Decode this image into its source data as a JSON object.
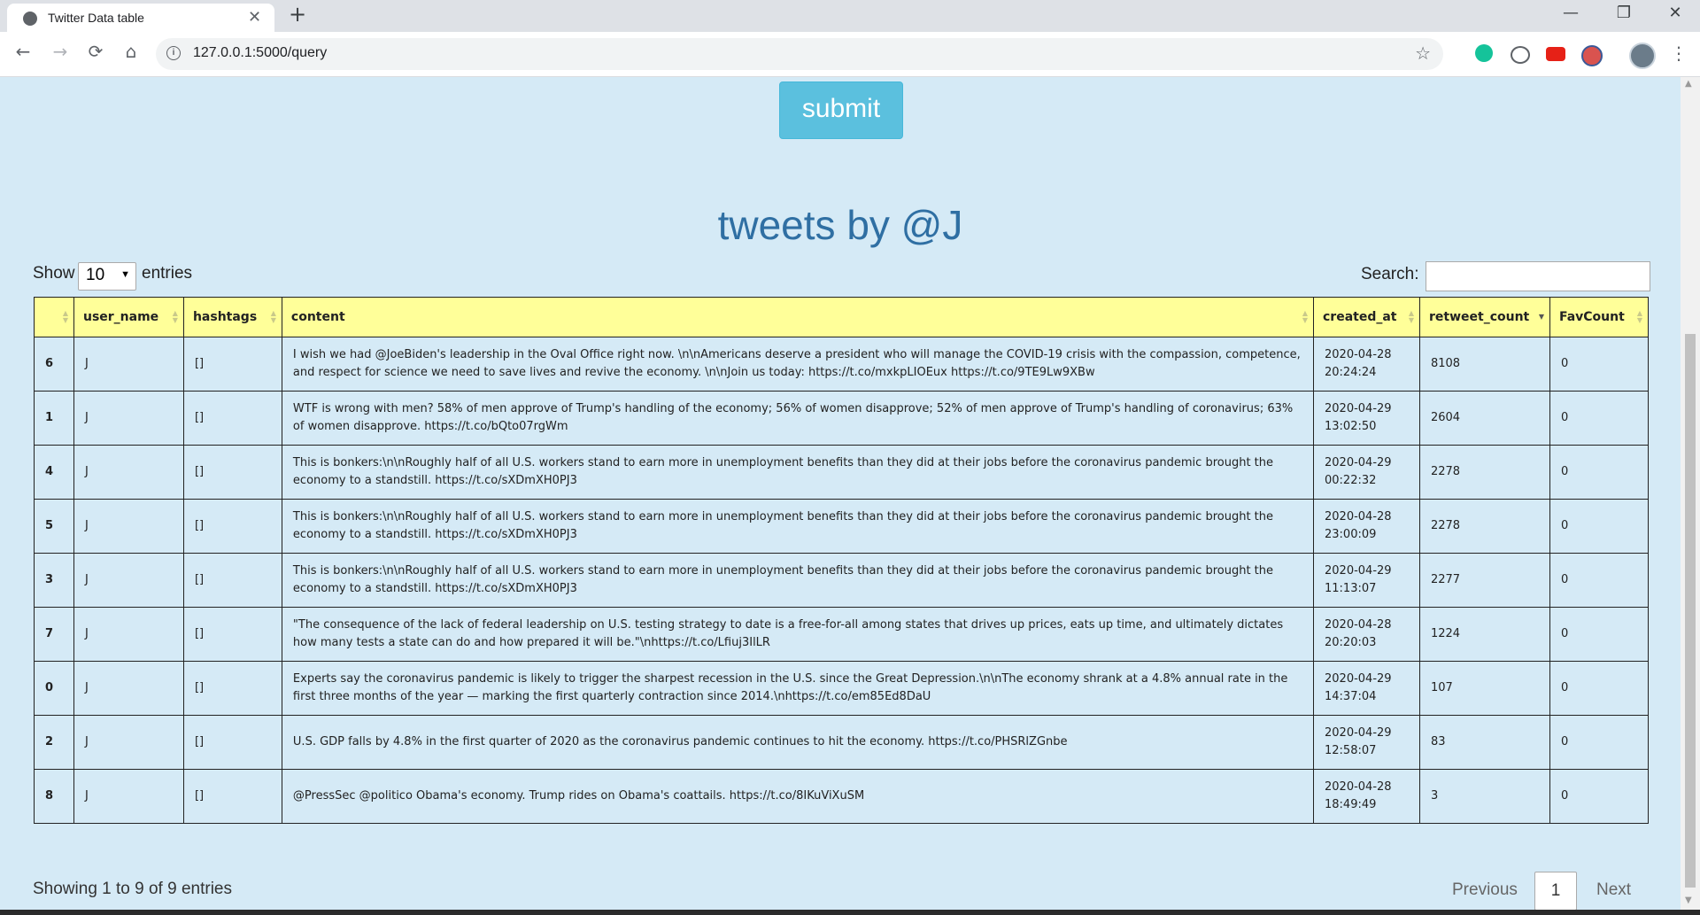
{
  "browser": {
    "tab_title": "Twitter Data table",
    "tab_close": "✕",
    "new_tab": "+",
    "url": "127.0.0.1:5000/query",
    "buttons": {
      "back": "←",
      "forward": "→",
      "reload": "⟳",
      "home": "⌂",
      "star": "☆",
      "menu": "⋮",
      "minimize": "—",
      "maximize": "❐",
      "close": "✕"
    },
    "icons": [
      "grammarly-icon",
      "extension-icon",
      "youtube-icon",
      "extension-icon-2"
    ],
    "colors": {
      "grammarly": "#15c39a",
      "youtube": "#e62117"
    }
  },
  "form": {
    "submit_label": "submit"
  },
  "page_title": "tweets by @J",
  "length_menu": {
    "show_label": "Show",
    "value": "10",
    "entries_label": "entries"
  },
  "search": {
    "label": "Search:",
    "value": ""
  },
  "table": {
    "columns": [
      "",
      "user_name",
      "hashtags",
      "content",
      "created_at",
      "retweet_count",
      "FavCount"
    ],
    "sorted_column": "retweet_count",
    "sort_direction": "desc",
    "rows": [
      [
        "6",
        "J",
        "[]",
        "I wish we had @JoeBiden's leadership in the Oval Office right now. \\n\\nAmericans deserve a president who will manage the COVID-19 crisis with the compassion, competence, and respect for science we need to save lives and revive the economy. \\n\\nJoin us today: https://t.co/mxkpLIOEux https://t.co/9TE9Lw9XBw",
        "2020-04-28 20:24:24",
        "8108",
        "0"
      ],
      [
        "1",
        "J",
        "[]",
        "WTF is wrong with men? 58% of men approve of Trump's handling of the economy; 56% of women disapprove; 52% of men approve of Trump's handling of coronavirus; 63% of women disapprove. https://t.co/bQto07rgWm",
        "2020-04-29 13:02:50",
        "2604",
        "0"
      ],
      [
        "4",
        "J",
        "[]",
        "This is bonkers:\\n\\nRoughly half of all U.S. workers stand to earn more in unemployment benefits than they did at their jobs before the coronavirus pandemic brought the economy to a standstill. https://t.co/sXDmXH0PJ3",
        "2020-04-29 00:22:32",
        "2278",
        "0"
      ],
      [
        "5",
        "J",
        "[]",
        "This is bonkers:\\n\\nRoughly half of all U.S. workers stand to earn more in unemployment benefits than they did at their jobs before the coronavirus pandemic brought the economy to a standstill. https://t.co/sXDmXH0PJ3",
        "2020-04-28 23:00:09",
        "2278",
        "0"
      ],
      [
        "3",
        "J",
        "[]",
        "This is bonkers:\\n\\nRoughly half of all U.S. workers stand to earn more in unemployment benefits than they did at their jobs before the coronavirus pandemic brought the economy to a standstill. https://t.co/sXDmXH0PJ3",
        "2020-04-29 11:13:07",
        "2277",
        "0"
      ],
      [
        "7",
        "J",
        "[]",
        "\"The consequence of the lack of federal leadership on U.S. testing strategy to date is a free-for-all among states that drives up prices, eats up time, and ultimately dictates how many tests a state can do and how prepared it will be.\"\\nhttps://t.co/Lfiuj3IlLR",
        "2020-04-28 20:20:03",
        "1224",
        "0"
      ],
      [
        "0",
        "J",
        "[]",
        "Experts say the coronavirus pandemic is likely to trigger the sharpest recession in the U.S. since the Great Depression.\\n\\nThe economy shrank at a 4.8% annual rate in the first three months of the year — marking the first quarterly contraction since 2014.\\nhttps://t.co/em85Ed8DaU",
        "2020-04-29 14:37:04",
        "107",
        "0"
      ],
      [
        "2",
        "J",
        "[]",
        "U.S. GDP falls by 4.8% in the first quarter of 2020 as the coronavirus pandemic continues to hit the economy. https://t.co/PHSRlZGnbe",
        "2020-04-29 12:58:07",
        "83",
        "0"
      ],
      [
        "8",
        "J",
        "[]",
        "@PressSec @politico Obama's economy. Trump rides on Obama's coattails. https://t.co/8IKuViXuSM",
        "2020-04-28 18:49:49",
        "3",
        "0"
      ]
    ]
  },
  "footer": {
    "info": "Showing 1 to 9 of 9 entries",
    "previous": "Previous",
    "current_page": "1",
    "next": "Next"
  },
  "theme": {
    "page_bg": "#d5eaf6",
    "header_bg": "#ffff99",
    "title_color": "#2f6fa3",
    "button_bg": "#5bc0de"
  }
}
